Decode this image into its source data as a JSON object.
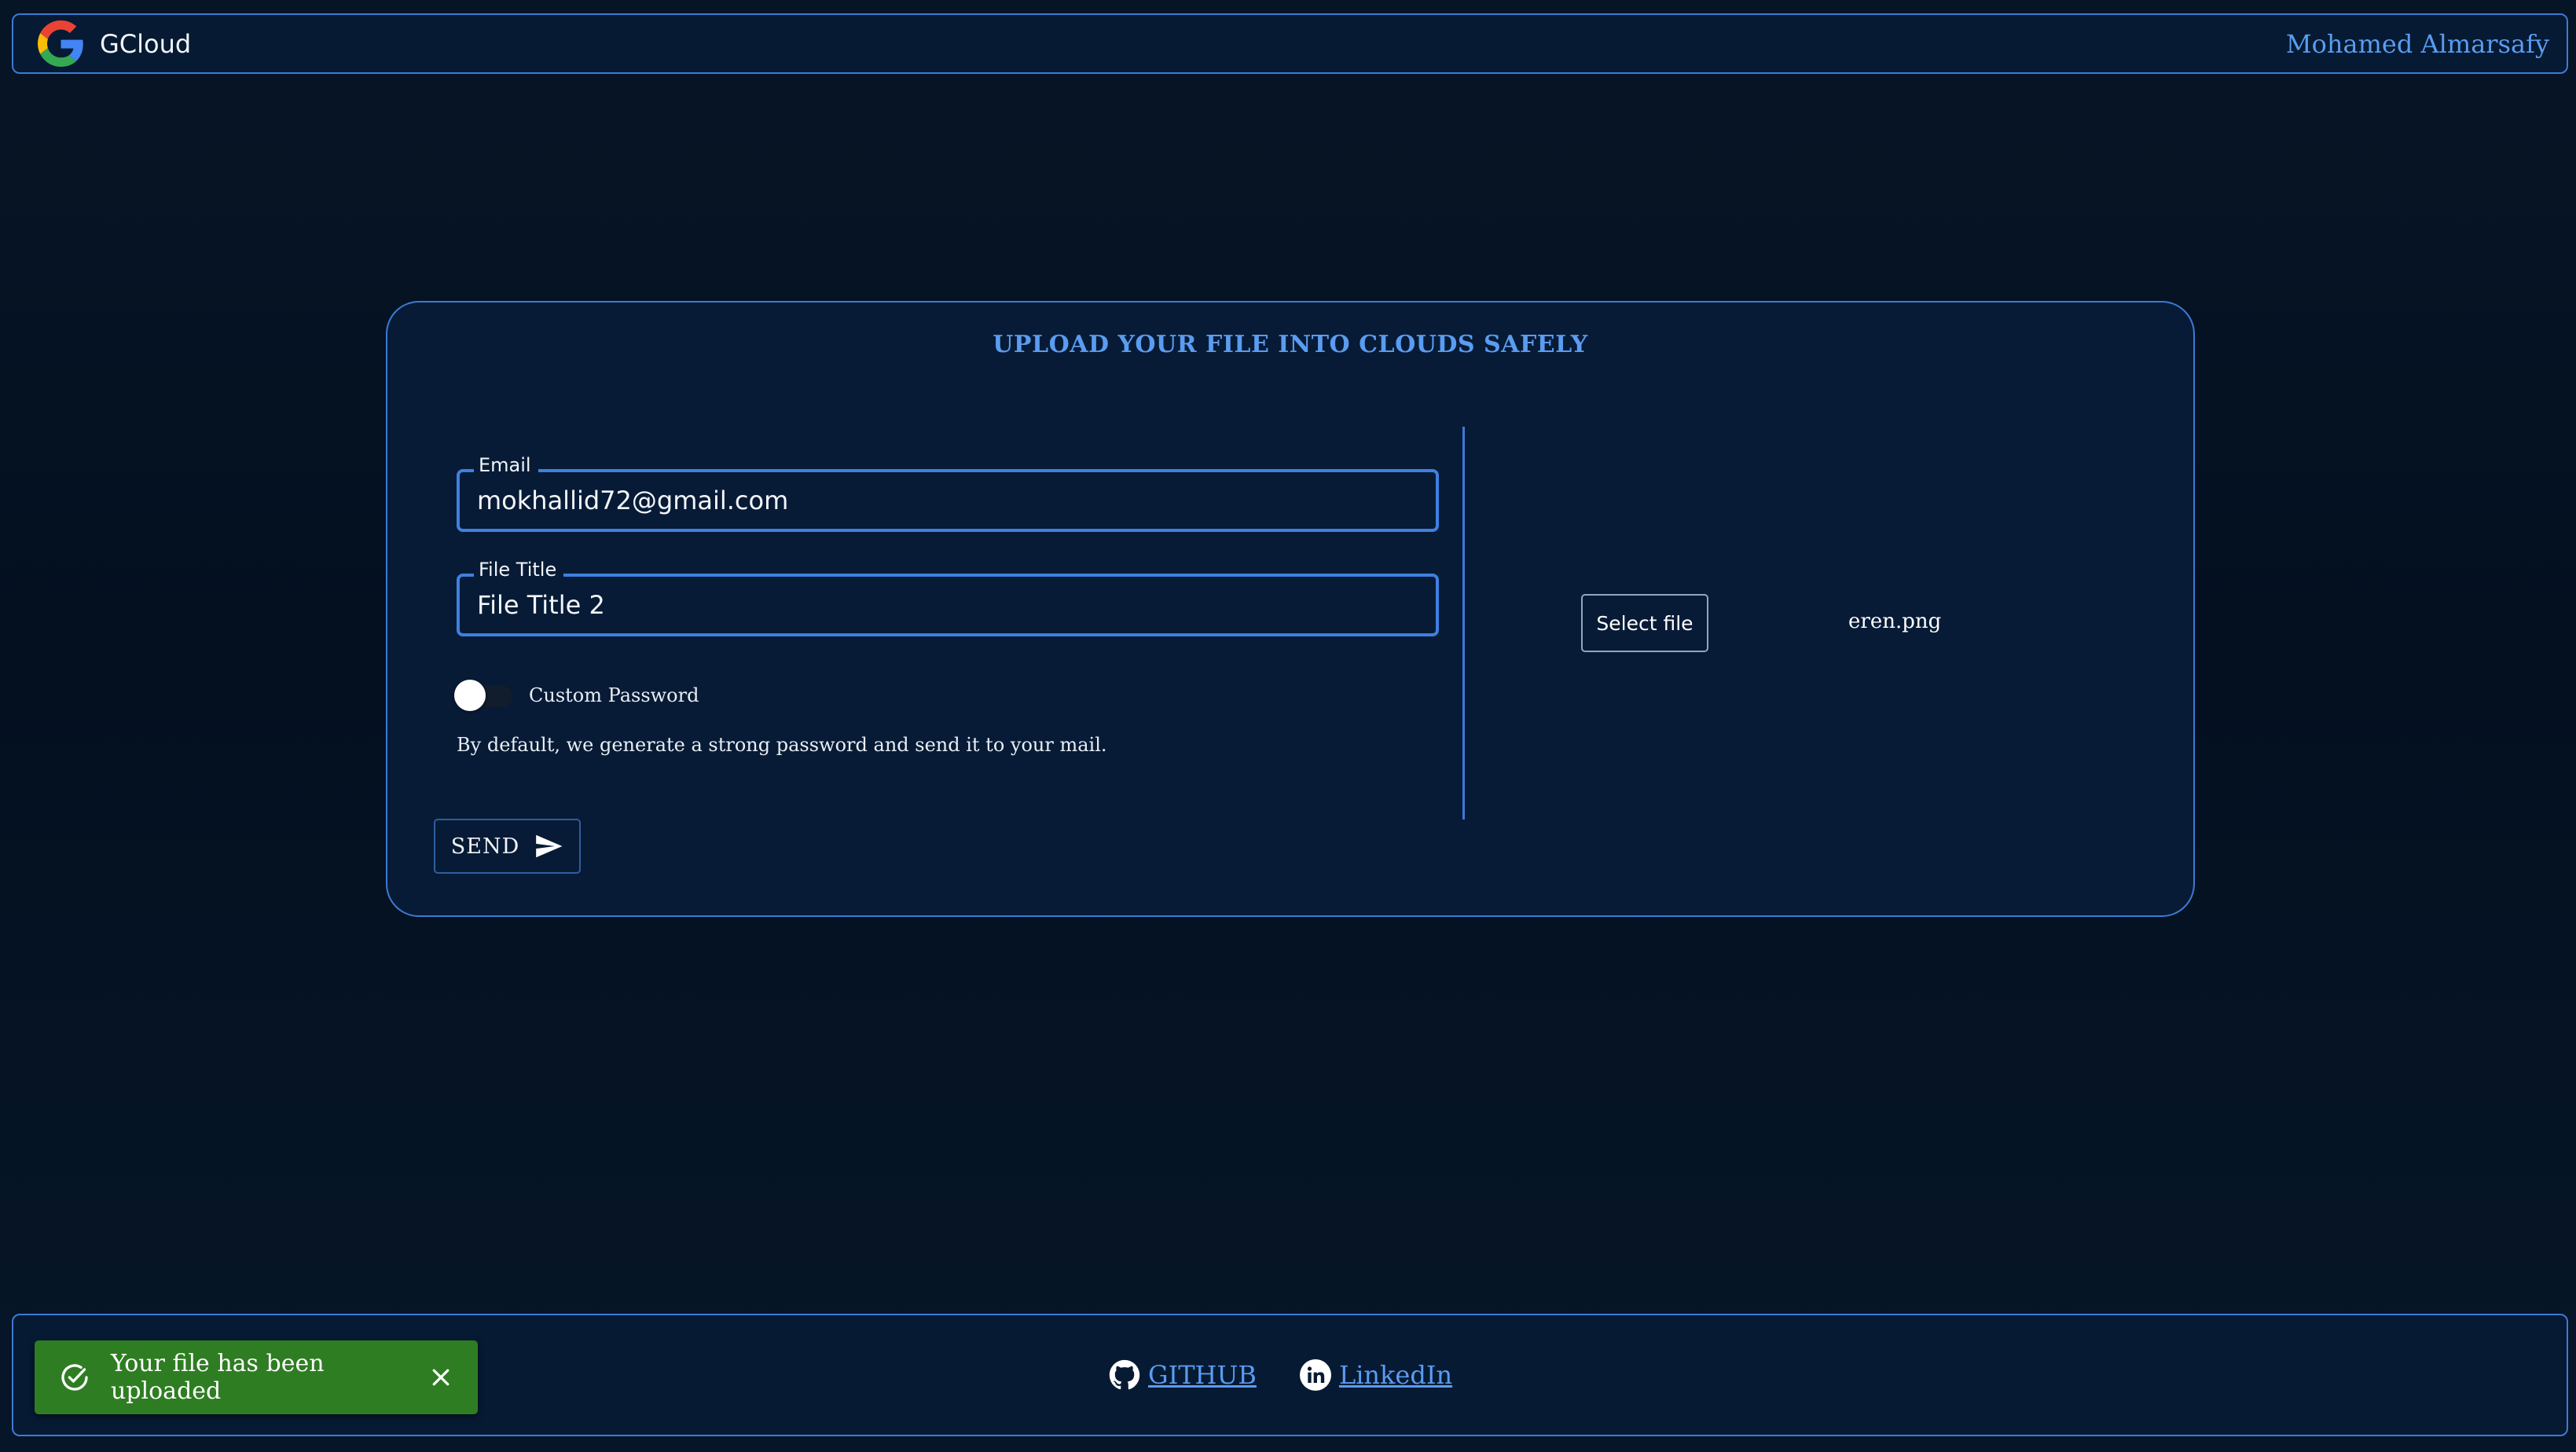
{
  "header": {
    "brand": "GCloud",
    "user_name": "Mohamed Almarsafy",
    "logo_icon": "google-g-icon"
  },
  "upload_card": {
    "title": "UPLOAD YOUR FILE INTO CLOUDS SAFELY",
    "email": {
      "label": "Email",
      "value": "mokhallid72@gmail.com"
    },
    "file_title": {
      "label": "File Title",
      "value": "File Title 2"
    },
    "custom_password": {
      "label": "Custom Password",
      "enabled": false
    },
    "hint": "By default, we generate a strong password and send it to your mail.",
    "send_button": {
      "label": "SEND",
      "icon": "send-icon"
    },
    "file_picker": {
      "button_label": "Select file",
      "selected_file": "eren.png"
    }
  },
  "footer": {
    "links": [
      {
        "label": "GITHUB",
        "icon": "github-icon"
      },
      {
        "label": "LinkedIn",
        "icon": "linkedin-icon"
      }
    ]
  },
  "toast": {
    "message": "Your file has been uploaded",
    "status": "success",
    "icon": "check-circle-icon",
    "close_icon": "close-icon"
  },
  "colors": {
    "background": "#051426",
    "panel": "#071b36",
    "accent": "#3d7ad6",
    "link": "#5a9cf0",
    "success": "#2e7d22"
  }
}
